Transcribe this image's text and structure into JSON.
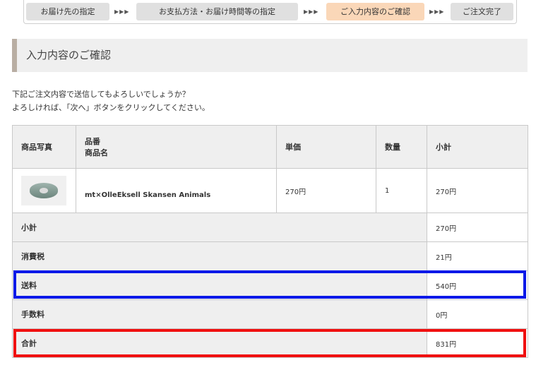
{
  "steps": {
    "items": [
      {
        "label": "お届け先の指定"
      },
      {
        "label": "お支払方法・お届け時間等の指定"
      },
      {
        "label": "ご入力内容のご確認"
      },
      {
        "label": "ご注文完了"
      }
    ],
    "separator": "▶▶▶",
    "active_index": 2
  },
  "page": {
    "title": "入力内容のご確認",
    "intro_line1": "下記ご注文内容で送信してもよろしいでしょうか？",
    "intro_line2": "よろしければ、「次へ」ボタンをクリックしてください。"
  },
  "table": {
    "headers": {
      "photo": "商品写真",
      "code": "品番",
      "name": "商品名",
      "unit_price": "単価",
      "quantity": "数量",
      "subtotal": "小計"
    },
    "items": [
      {
        "image": "washi-tape-roll",
        "code": "",
        "name": "mt×OlleEksell Skansen Animals",
        "unit_price": "270円",
        "quantity": "1",
        "subtotal": "270円"
      }
    ],
    "summary": {
      "subtotal_label": "小計",
      "subtotal_value": "270円",
      "tax_label": "消費税",
      "tax_value": "21円",
      "shipping_label": "送料",
      "shipping_value": "540円",
      "fee_label": "手数料",
      "fee_value": "0円",
      "total_label": "合計",
      "total_value": "831円"
    }
  },
  "highlights": {
    "shipping_color": "#0a19e8",
    "total_color": "#f01010"
  }
}
